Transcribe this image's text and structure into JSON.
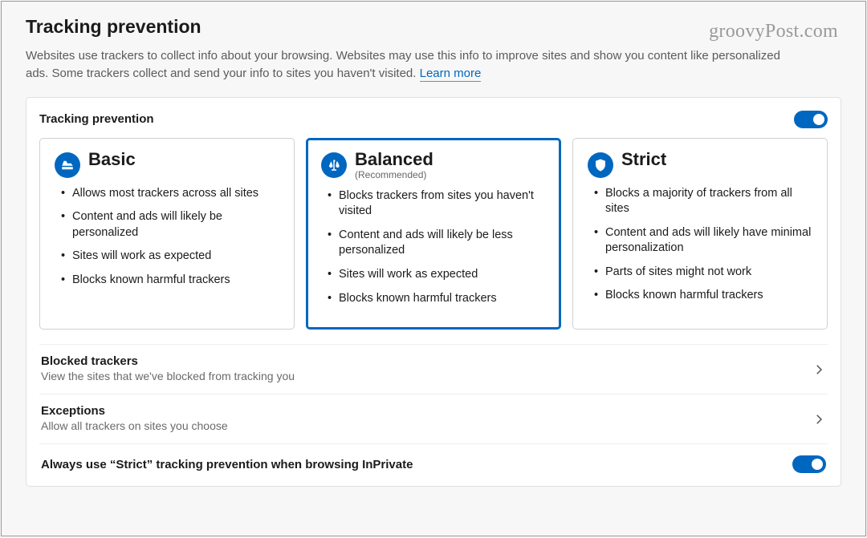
{
  "watermark": "groovyPost.com",
  "header": {
    "title": "Tracking prevention",
    "description": "Websites use trackers to collect info about your browsing. Websites may use this info to improve sites and show you content like personalized ads. Some trackers collect and send your info to sites you haven't visited.",
    "learn_more": "Learn more"
  },
  "panel": {
    "title": "Tracking prevention",
    "toggle_on": true
  },
  "levels": {
    "basic": {
      "title": "Basic",
      "items": [
        "Allows most trackers across all sites",
        "Content and ads will likely be personalized",
        "Sites will work as expected",
        "Blocks known harmful trackers"
      ]
    },
    "balanced": {
      "title": "Balanced",
      "subtitle": "(Recommended)",
      "items": [
        "Blocks trackers from sites you haven't visited",
        "Content and ads will likely be less personalized",
        "Sites will work as expected",
        "Blocks known harmful trackers"
      ]
    },
    "strict": {
      "title": "Strict",
      "items": [
        "Blocks a majority of trackers from all sites",
        "Content and ads will likely have minimal personalization",
        "Parts of sites might not work",
        "Blocks known harmful trackers"
      ]
    }
  },
  "rows": {
    "blocked": {
      "title": "Blocked trackers",
      "subtitle": "View the sites that we've blocked from tracking you"
    },
    "exceptions": {
      "title": "Exceptions",
      "subtitle": "Allow all trackers on sites you choose"
    },
    "inprivate": {
      "label": "Always use “Strict” tracking prevention when browsing InPrivate",
      "toggle_on": true
    }
  },
  "colors": {
    "accent": "#0067c0"
  }
}
